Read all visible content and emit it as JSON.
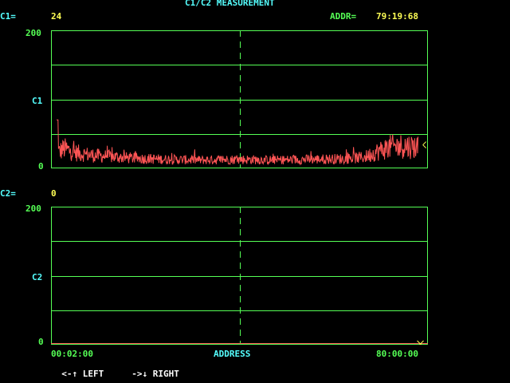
{
  "title": "C1/C2 MEASUREMENT",
  "colors": {
    "background": "#000000",
    "label": "#55ffff",
    "value": "#ffff55",
    "grid": "#55ff55",
    "trace": "#ff5555",
    "marker": "#ffff55"
  },
  "c1": {
    "label": "C1=",
    "value": "24",
    "y_top": "200",
    "y_mid": "C1",
    "y_zero": "0"
  },
  "c2": {
    "label": "C2=",
    "value": "0",
    "y_top": "200",
    "y_mid": "C2",
    "y_zero": "0"
  },
  "addr": {
    "label": "ADDR=",
    "value": "79:19:68"
  },
  "x_axis": {
    "start": "00:02:00",
    "label": "ADDRESS",
    "end": "80:00:00"
  },
  "nav": {
    "left": "<-",
    "left_arrow_icon": "up-arrow-icon",
    "left_label": "LEFT",
    "right": "->",
    "right_arrow_icon": "down-arrow-icon",
    "right_label": "RIGHT"
  },
  "chart_data": [
    {
      "type": "line",
      "ylim": [
        0,
        200
      ],
      "cursor_position": 0.5,
      "grid": true,
      "series": [
        {
          "profile": [
            [
              0.0,
              20
            ],
            [
              0.02,
              28
            ],
            [
              0.05,
              22
            ],
            [
              0.1,
              18
            ],
            [
              0.2,
              14
            ],
            [
              0.3,
              12
            ],
            [
              0.4,
              11
            ],
            [
              0.5,
              12
            ],
            [
              0.6,
              11
            ],
            [
              0.7,
              12
            ],
            [
              0.8,
              13
            ],
            [
              0.85,
              15
            ],
            [
              0.88,
              22
            ],
            [
              0.92,
              30
            ],
            [
              0.96,
              32
            ],
            [
              1.0,
              30
            ]
          ]
        }
      ],
      "marker": {
        "position": 0.995,
        "value": 24
      }
    },
    {
      "type": "line",
      "ylim": [
        0,
        200
      ],
      "cursor_position": 0.5,
      "grid": true,
      "series": [
        {
          "profile": [
            [
              0.0,
              0
            ],
            [
              1.0,
              0
            ]
          ]
        }
      ],
      "marker": {
        "position": 0.98,
        "value": 0
      }
    }
  ]
}
